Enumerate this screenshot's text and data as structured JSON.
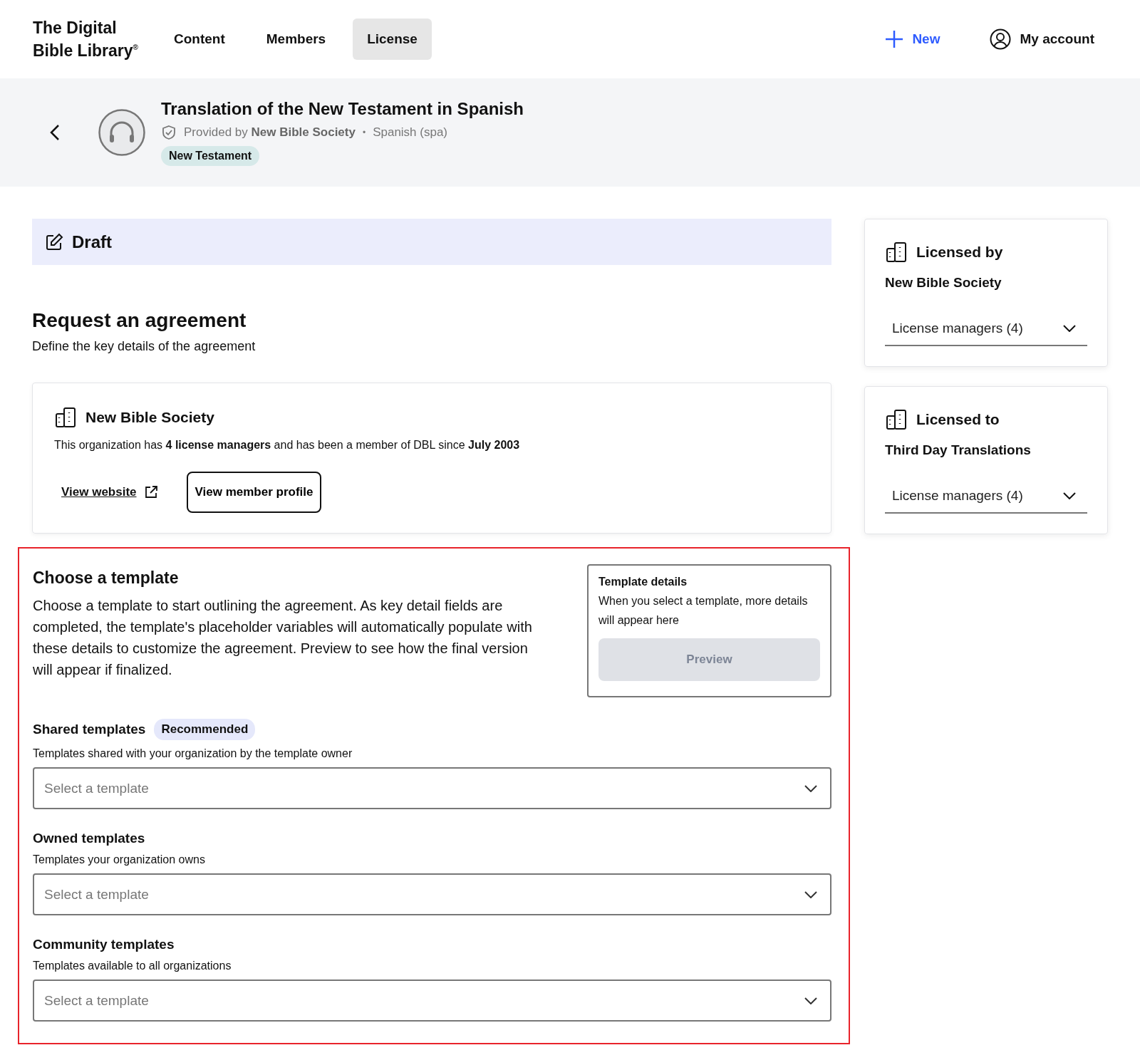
{
  "header": {
    "logo_line_1": "The Digital",
    "logo_line_2": "Bible Library",
    "logo_mark": "®",
    "tabs": [
      {
        "label": "Content",
        "selected": false
      },
      {
        "label": "Members",
        "selected": false
      },
      {
        "label": "License",
        "selected": true
      }
    ],
    "new_button": "New",
    "account_button": "My account"
  },
  "resource": {
    "title": "Translation of the New Testament in Spanish",
    "provided_by": "Provided by **New Bible Society**",
    "separator": "•",
    "language": "Spanish (spa)",
    "tag": "New Testament"
  },
  "status": {
    "label": "Draft"
  },
  "request": {
    "title": "Request an agreement",
    "subtitle": "Define the key details of the agreement"
  },
  "organization": {
    "name": "New Bible Society",
    "description": "This organization has **4 license managers** and has been a member of DBL since **July 2003**",
    "website_link": "View website",
    "profile_button": "View member profile"
  },
  "choose_template": {
    "highlighted": true,
    "title": "Choose a template",
    "description": "Choose a template to start outlining the agreement. As key detail fields are completed, the template's placeholder variables will automatically populate with these details to customize the agreement. Preview to see how the final version will appear if finalized.",
    "details": {
      "title": "Template details",
      "text": "When you select a template, more details will appear here",
      "preview_button": "Preview",
      "preview_disabled": true
    },
    "groups": [
      {
        "title": "Shared templates",
        "badge": "Recommended",
        "description": "Templates shared with your organization by the template owner",
        "placeholder": "Select a template"
      },
      {
        "title": "Owned templates",
        "description": "Templates your organization owns",
        "placeholder": "Select a template"
      },
      {
        "title": "Community templates",
        "description": "Templates available to all organizations",
        "placeholder": "Select a template"
      }
    ]
  },
  "sidebar": [
    {
      "heading": "Licensed by",
      "organization": "New Bible Society",
      "managers": "License managers (4)"
    },
    {
      "heading": "Licensed to",
      "organization": "Third Day Translations",
      "managers": "License managers (4)"
    }
  ]
}
